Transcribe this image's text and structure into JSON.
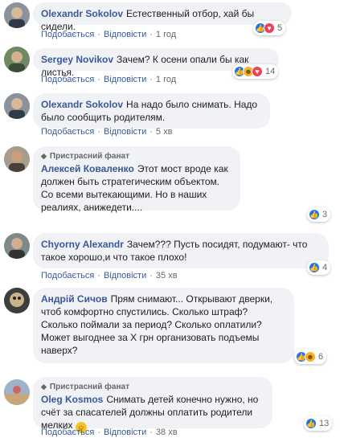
{
  "labels": {
    "like": "Подобається",
    "reply": "Відповісти",
    "fan_badge": "Пристрасний фанат",
    "sep": "·"
  },
  "comments": [
    {
      "name": "Olexandr Sokolov",
      "text": "Естественный отбор, хай бы сидели.",
      "time": "1 год",
      "reaction_count": "5",
      "reactions": [
        "like-icon",
        "love-icon"
      ]
    },
    {
      "name": "Sergey Novikov",
      "text": "Зачем? К осени опали бы как листья.",
      "time": "1 год",
      "reaction_count": "14",
      "reactions": [
        "like-icon",
        "haha-icon",
        "love-icon"
      ]
    },
    {
      "name": "Olexandr Sokolov",
      "text": "На надо было снимать. Надо было сообщить родителям.",
      "time": "5 хв"
    },
    {
      "name": "Алексей Коваленко",
      "fan": true,
      "text": "Этот мост вроде как должен быть стратегическим объектом. Со всеми вытекающими. Но в наших реалиях, анижедети....",
      "time": "",
      "reaction_count": "3",
      "reactions": [
        "like-icon"
      ]
    },
    {
      "name": "Chyorny Alexandr",
      "text": "Зачем??? Пусть посидят, подумают- что такое хорошо,и что такое плохо!",
      "time": "35 хв",
      "reaction_count": "4",
      "reactions": [
        "like-icon"
      ]
    },
    {
      "name": "Андрій Сичов",
      "text": "Прям снимают... Открывают дверки, чтоб комфортно спустились. Сколько штраф? Сколько поймали за период? Сколько оплатили? Может выгоднее за Х грн организовать подъемы наверх?",
      "time": "",
      "reaction_count": "6",
      "reactions": [
        "like-icon",
        "haha-icon"
      ]
    },
    {
      "name": "Oleg Kosmos",
      "fan": true,
      "text": "Снимать детей конечно нужно, но счёт за спасателей должны оплатить родители мелких",
      "time": "38 хв",
      "reaction_count": "13",
      "reactions": [
        "like-icon"
      ]
    }
  ]
}
